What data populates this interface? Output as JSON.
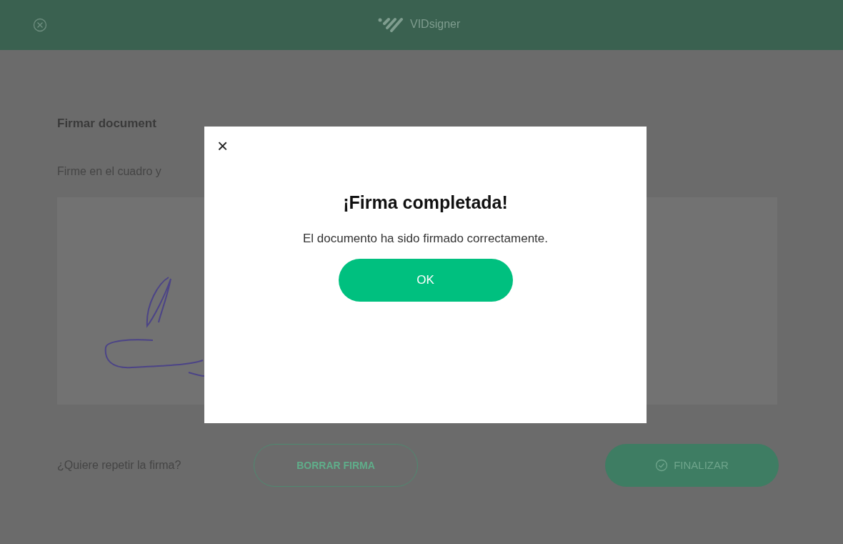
{
  "header": {
    "brand": "VIDsigner"
  },
  "page": {
    "title": "Firmar document",
    "instruction": "Firme en el cuadro y"
  },
  "footer": {
    "question": "¿Quiere repetir la firma?",
    "clear_button": "BORRAR FIRMA",
    "finish_button": "FINALIZAR"
  },
  "dialog": {
    "close": "×",
    "title": "¡Firma completada!",
    "message": "El documento ha sido firmado correctamente.",
    "ok_button": "OK"
  }
}
